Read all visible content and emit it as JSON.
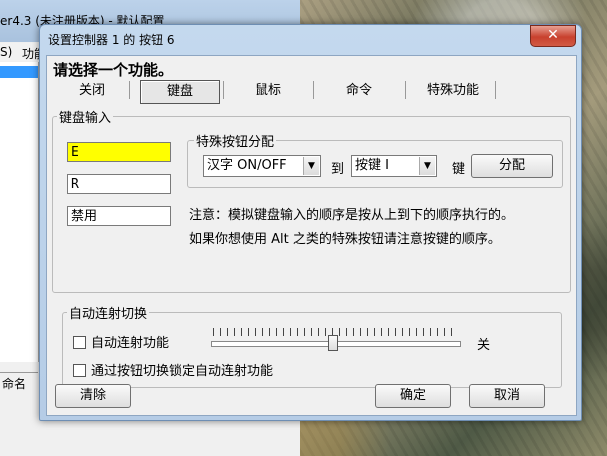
{
  "background_window": {
    "title": "er4.3 (未注册版本) - 默认配置",
    "menu_items": [
      "S)",
      "功能"
    ],
    "footer_label": "命名"
  },
  "dialog": {
    "title": "设置控制器 1 的 按钮 6",
    "close_glyph": "✕",
    "prompt": "请选择一个功能。",
    "tabs": [
      {
        "label": "关闭",
        "selected": false
      },
      {
        "label": "键盘",
        "selected": true
      },
      {
        "label": "鼠标",
        "selected": false
      },
      {
        "label": "命令",
        "selected": false
      },
      {
        "label": "特殊功能",
        "selected": false
      }
    ],
    "keyboard_group": {
      "legend": "键盘输入",
      "key_fields": [
        "E",
        "R",
        "禁用"
      ],
      "special_group": {
        "legend": "特殊按钮分配",
        "combo_left": "汉字 ON/OFF",
        "to_label": "到",
        "combo_right": "按键 I",
        "key_label": "键",
        "assign_button": "分配"
      },
      "note_line1": "注意：模拟键盘输入的顺序是按从上到下的顺序执行的。",
      "note_line2": "如果你想使用 Alt 之类的特殊按钮请注意按键的顺序。"
    },
    "autofire_group": {
      "legend": "自动连射切换",
      "autofire_label": "自动连射功能",
      "autofire_checked": false,
      "slider_state": "关",
      "lock_label": "通过按钮切换锁定自动连射功能",
      "lock_checked": false
    },
    "buttons": {
      "clear": "清除",
      "ok": "确定",
      "cancel": "取消"
    }
  }
}
